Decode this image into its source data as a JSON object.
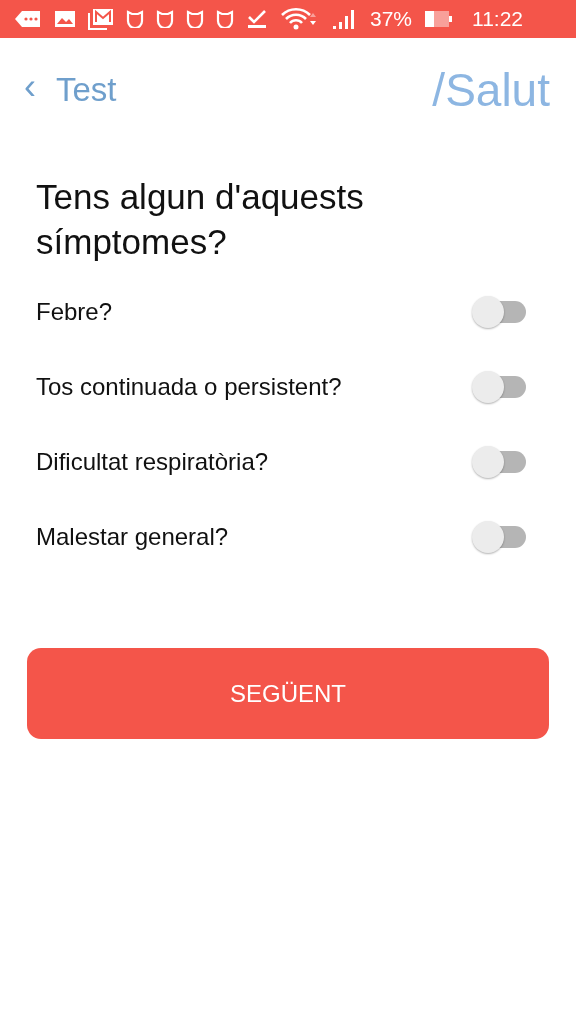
{
  "status_bar": {
    "battery": "37%",
    "time": "11:22"
  },
  "nav": {
    "back": "‹",
    "back_label": "Test",
    "brand": "/Salut"
  },
  "question": "Tens algun d'aquests símptomes?",
  "symptoms": [
    {
      "label": "Febre?",
      "on": false
    },
    {
      "label": "Tos continuada o persistent?",
      "on": false
    },
    {
      "label": "Dificultat respiratòria?",
      "on": false
    },
    {
      "label": "Malestar general?",
      "on": false
    }
  ],
  "next_button": "SEGÜENT"
}
